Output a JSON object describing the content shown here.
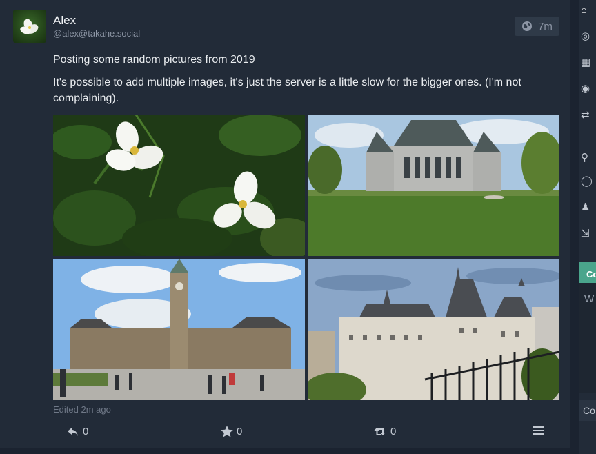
{
  "post": {
    "author_name": "Alex",
    "author_handle": "@alex@takahe.social",
    "time": "7m",
    "visibility_icon": "globe-icon",
    "paragraphs": [
      "Posting some random pictures from 2019",
      "It's possible to add multiple images, it's just the server is a little slow for the bigger ones. (I'm not complaining)."
    ],
    "attachments": [
      {
        "name": "trillium-flowers-photo"
      },
      {
        "name": "supreme-court-building-photo"
      },
      {
        "name": "parliament-hill-photo"
      },
      {
        "name": "chateau-laurier-photo"
      }
    ],
    "edited": "Edited 2m ago",
    "actions": {
      "reply_count": "0",
      "favourite_count": "0",
      "boost_count": "0"
    }
  },
  "sidebar": {
    "compose_label": "Co",
    "compose_placeholder": "W",
    "input_label": "Co"
  },
  "colors": {
    "background": "#1b2330",
    "card": "#222b38",
    "accent": "#4aa58c",
    "muted_text": "#8c95a4"
  }
}
